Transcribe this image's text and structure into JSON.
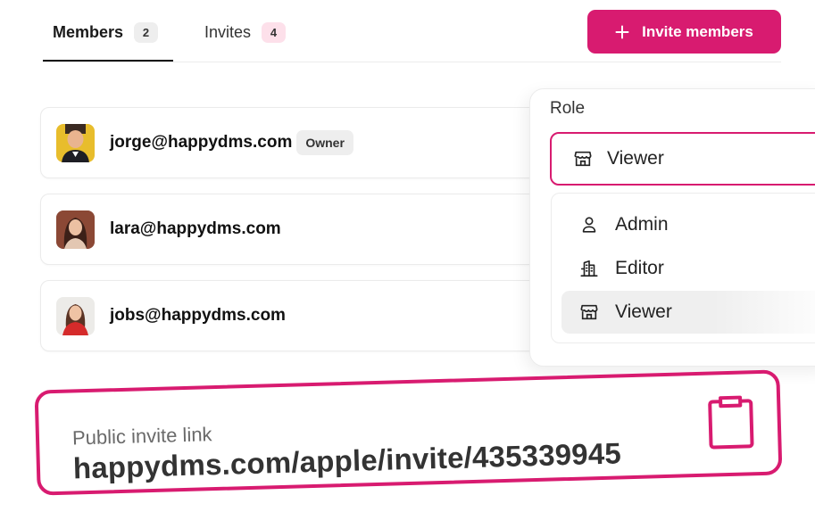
{
  "tabs": [
    {
      "label": "Members",
      "count": "2"
    },
    {
      "label": "Invites",
      "count": "4"
    }
  ],
  "invite_button": {
    "label": "Invite members",
    "icon": "plus-icon"
  },
  "members": [
    {
      "email": "jorge@happydms.com",
      "badge": "Owner"
    },
    {
      "email": "lara@happydms.com"
    },
    {
      "email": "jobs@happydms.com"
    }
  ],
  "role_dropdown": {
    "label": "Role",
    "selected": "Viewer",
    "options": [
      {
        "label": "Admin",
        "icon": "person-icon"
      },
      {
        "label": "Editor",
        "icon": "building-icon"
      },
      {
        "label": "Viewer",
        "icon": "storefront-icon"
      }
    ]
  },
  "invite_link": {
    "label": "Public invite link",
    "url": "happydms.com/apple/invite/435339945",
    "icon": "clipboard-icon"
  },
  "colors": {
    "accent": "#d81b70",
    "badge_pink": "#fde0ea",
    "badge_gray": "#eeeeee"
  }
}
